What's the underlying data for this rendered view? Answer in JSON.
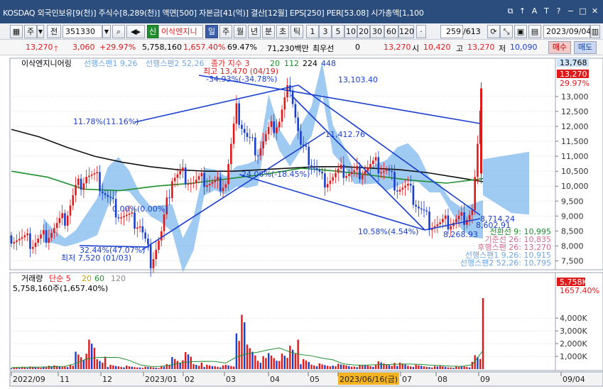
{
  "window": {
    "title": "KOSDAQ 외국인보유[9(천)] 주식수[8,289(천)] 액면[500] 자본금[41(억)] 결산[12월] EPS[250] PER[53.08] 시가총액[1,100",
    "controls": [
      "⧉",
      "↑",
      "A",
      "T",
      "?",
      "−",
      "□",
      "✕"
    ]
  },
  "toolbar": {
    "market_label": "주",
    "prev_label": "전",
    "code": "351330",
    "badge_new": "신",
    "stock_name": "이삭엔지니",
    "period_buttons": [
      "일",
      "주",
      "월",
      "년",
      "분",
      "초",
      "틱"
    ],
    "minute_buttons": [
      "1",
      "3",
      "5",
      "10",
      "20",
      "30",
      "60",
      "120"
    ],
    "count": "259",
    "total": "/613",
    "date": "2023/09/04"
  },
  "quote": {
    "price": "13,270",
    "change": "3,060",
    "change_pct": "+29.97%",
    "volume": "5,758,160",
    "volume_pct": "1,657.40%",
    "turnover": "69.47%",
    "amount": "71,230백만",
    "priority_label": "최우선",
    "priority_value": "0",
    "last": "13,270",
    "open_label": "시",
    "open": "10,420",
    "high_label": "고",
    "high": "13,270",
    "low_label": "저",
    "low": "10,090",
    "buy_label": "매수",
    "sell_label": "매도"
  },
  "chart_data": [
    {
      "type": "candlestick",
      "title": "이삭엔지니어링",
      "indicators": [
        "선행스팬1 9,26",
        "선행스팬2 52,26",
        "종가 지수 3",
        "20",
        "112",
        "224",
        "448"
      ],
      "ylim": [
        7250,
        13900
      ],
      "y_ticks": [
        7500,
        8000,
        8500,
        9000,
        9500,
        10000,
        10500,
        11000,
        11500,
        12000,
        12500,
        13000
      ],
      "y_tick_labels": [
        "7,500",
        "8,000",
        "8,500",
        "9,000",
        "9,500",
        "10,000",
        "10,500",
        "11,000",
        "11,500",
        "12,000",
        "12,500",
        "13,000"
      ],
      "x_labels": [
        "2022/09",
        "11",
        "12",
        "2023/01",
        "02",
        "03",
        "04",
        "05",
        "2023/06/16(금)",
        "07",
        "08",
        "09",
        "09/04"
      ],
      "price_tags": [
        {
          "text": "13,768",
          "color": "#cfe3f7",
          "fg": "#000"
        },
        {
          "text": "13,270",
          "color": "#e0191b",
          "fg": "#fff"
        },
        {
          "text": "29.97%",
          "color": "none",
          "fg": "#e0191b"
        }
      ],
      "annotations": [
        {
          "text": "최고 13,470 (04/19)",
          "color": "#e0191b"
        },
        {
          "text": "-34.93%(-34.78%)",
          "color": "#1a3fd0"
        },
        {
          "text": "13,103.40",
          "color": "#1a3fd0"
        },
        {
          "text": "11.78%(11.16%)",
          "color": "#1a3fd0"
        },
        {
          "text": "11,412.76",
          "color": "#1a3fd0"
        },
        {
          "text": "-24.06%(-18.45%)",
          "color": "#1a3fd0"
        },
        {
          "text": "0.00%(0.00%)",
          "color": "#1a3fd0"
        },
        {
          "text": "32.44%(47.07%)",
          "color": "#1a3fd0"
        },
        {
          "text": "최저 7,520 (01/03)",
          "color": "#1a3fd0"
        },
        {
          "text": "10.58%(4.54%)",
          "color": "#1a3fd0"
        },
        {
          "text": "8,268.93",
          "color": "#1a3fd0"
        },
        {
          "text": "8,714.24",
          "color": "#1a3fd0"
        },
        {
          "text": "8,602.91",
          "color": "#1a3fd0"
        }
      ],
      "legend_right": [
        {
          "text": "전환선 9: 10,995",
          "color": "#1f8f2e"
        },
        {
          "text": "기준선 26: 10,835",
          "color": "#d06c8f"
        },
        {
          "text": "후행스팬 26: 13,270",
          "color": "#d06c8f"
        },
        {
          "text": "선행스팬1 9,26: 10,915",
          "color": "#6fa7e6"
        },
        {
          "text": "선행스팬2 52,26: 10,795",
          "color": "#6fa7e6"
        }
      ],
      "series": [
        {
          "name": "종가",
          "values": [
            8350,
            8200,
            8100,
            8300,
            8600,
            8900,
            9900,
            10400,
            10200,
            9600,
            9100,
            8900,
            8700,
            7520,
            8400,
            10300,
            10400,
            10100,
            10200,
            10050,
            10150,
            12500,
            11600,
            11200,
            11800,
            12200,
            13470,
            11300,
            10800,
            10200,
            10300,
            10500,
            10400,
            10600,
            10700,
            10500,
            10000,
            9900,
            9300,
            8800,
            8700,
            8800,
            8900,
            9200,
            13270
          ]
        },
        {
          "name": "224",
          "values": [
            11900,
            11650,
            11300,
            11000,
            10800,
            10650,
            10550,
            10500,
            10500,
            10550,
            10600,
            10650,
            10650,
            10600,
            10550,
            10450,
            10300,
            10150
          ]
        },
        {
          "name": "112",
          "values": [
            10500,
            10300,
            9900,
            9850,
            10000,
            10100,
            10250,
            10400,
            10600,
            10500,
            10350,
            10200,
            10100,
            10250
          ]
        }
      ]
    },
    {
      "type": "bar",
      "title": "거래량",
      "indicators": [
        "단순 5",
        "20",
        "60",
        "120"
      ],
      "current_value": "5,758,160주(1,657.40%)",
      "ylim": [
        0,
        5900000
      ],
      "y_ticks": [
        1000000,
        2000000,
        3000000,
        4000000
      ],
      "y_tick_labels": [
        "1,000K",
        "2,000K",
        "3,000K",
        "4,000K"
      ],
      "price_tags": [
        {
          "text": "5,758K",
          "color": "#e0191b",
          "fg": "#fff"
        },
        {
          "text": "1657.40%",
          "color": "none",
          "fg": "#e0191b"
        }
      ],
      "values": [
        120000,
        180000,
        150000,
        220000,
        260000,
        280000,
        1300000,
        1900000,
        800000,
        300000,
        250000,
        180000,
        160000,
        140000,
        350000,
        900000,
        1100000,
        420000,
        300000,
        260000,
        280000,
        3500000,
        1700000,
        900000,
        1200000,
        1000000,
        1900000,
        700000,
        400000,
        300000,
        350000,
        300000,
        280000,
        320000,
        500000,
        400000,
        450000,
        300000,
        250000,
        200000,
        220000,
        180000,
        240000,
        900000,
        5758160
      ]
    }
  ]
}
